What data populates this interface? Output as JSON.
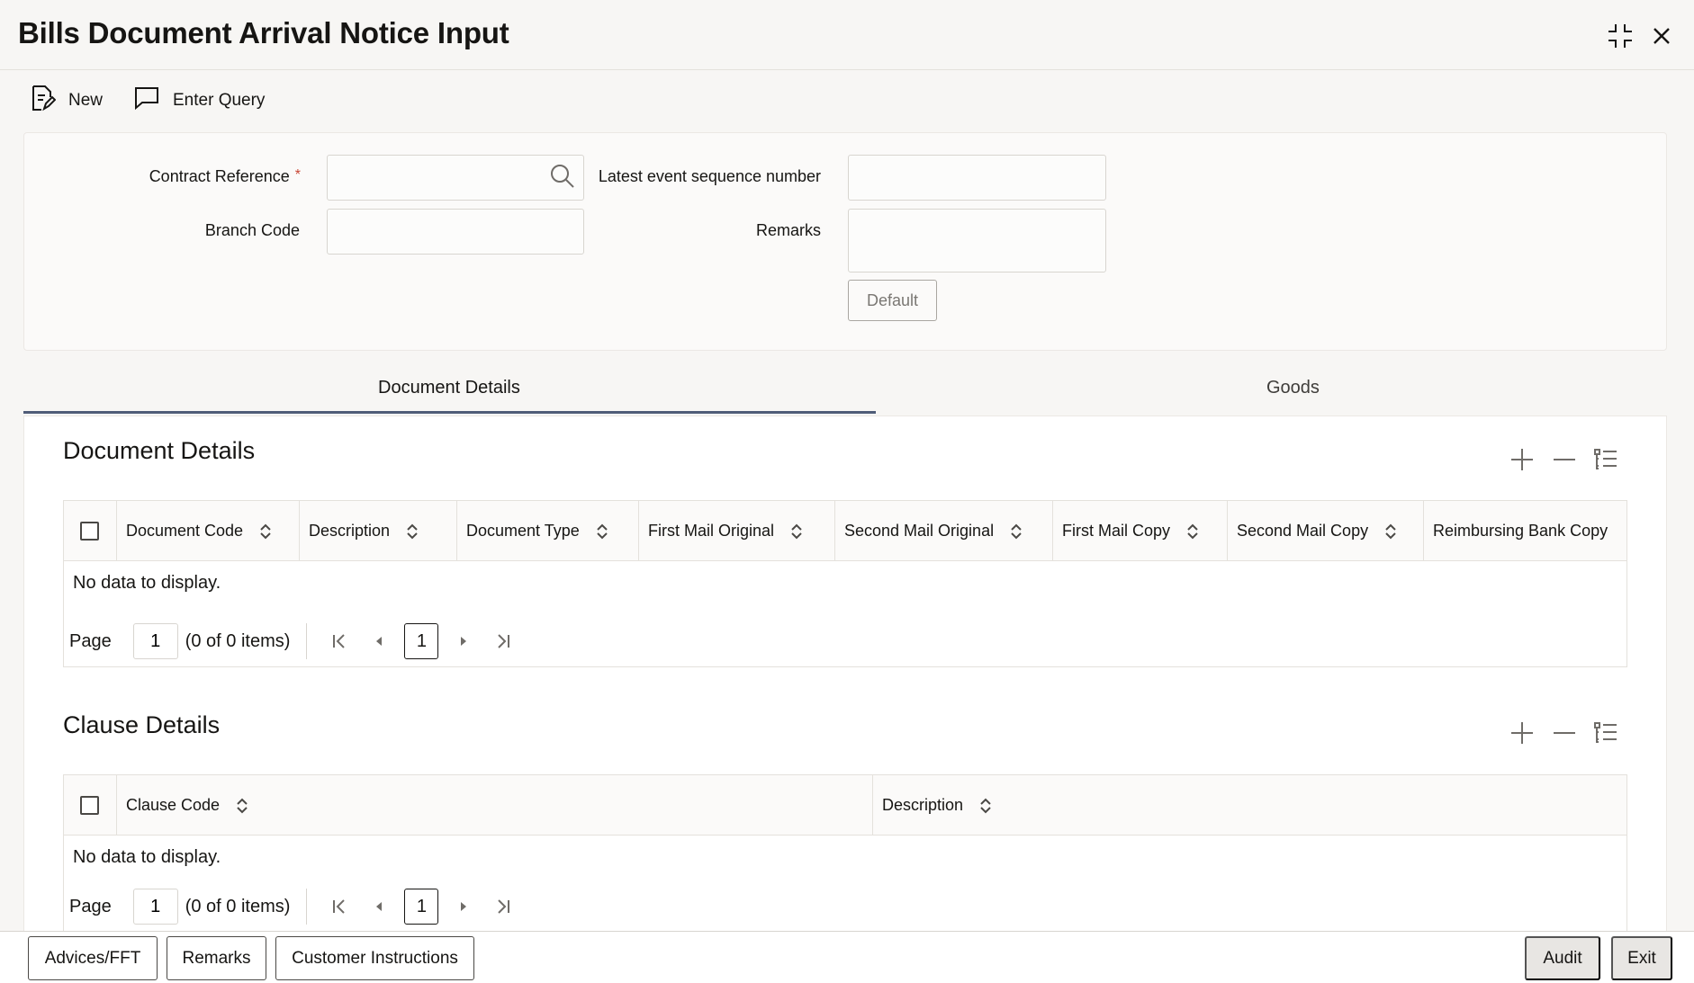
{
  "window": {
    "title": "Bills Document Arrival Notice Input",
    "icons": {
      "collapse": "collapse-icon",
      "close": "close-icon"
    }
  },
  "toolbar": {
    "new_label": "New",
    "enter_query_label": "Enter Query"
  },
  "form": {
    "contract_reference_label": "Contract Reference",
    "required_marker": "*",
    "contract_reference_value": "",
    "branch_code_label": "Branch Code",
    "branch_code_value": "",
    "latest_event_seq_label": "Latest event sequence number",
    "latest_event_seq_value": "",
    "remarks_label": "Remarks",
    "remarks_value": "",
    "default_button": "Default"
  },
  "tabs": [
    {
      "label": "Document Details",
      "active": true
    },
    {
      "label": "Goods",
      "active": false
    }
  ],
  "document_details": {
    "title": "Document Details",
    "columns": [
      "Document Code",
      "Description",
      "Document Type",
      "First Mail Original",
      "Second Mail Original",
      "First Mail Copy",
      "Second Mail Copy",
      "Reimbursing Bank Copy"
    ],
    "rows": [],
    "no_data": "No data to display.",
    "pager": {
      "page_label": "Page",
      "page_value": "1",
      "items_text": "(0 of 0 items)",
      "current": "1"
    }
  },
  "clause_details": {
    "title": "Clause Details",
    "columns": [
      "Clause Code",
      "Description"
    ],
    "rows": [],
    "no_data": "No data to display.",
    "pager": {
      "page_label": "Page",
      "page_value": "1",
      "items_text": "(0 of 0 items)",
      "current": "1"
    }
  },
  "footer": {
    "advices_label": "Advices/FFT",
    "remarks_label": "Remarks",
    "customer_instructions_label": "Customer Instructions",
    "audit_label": "Audit",
    "exit_label": "Exit"
  },
  "colors": {
    "accent_tab_underline": "#4f5d78",
    "required": "#c74634",
    "background": "#f7f6f4"
  }
}
